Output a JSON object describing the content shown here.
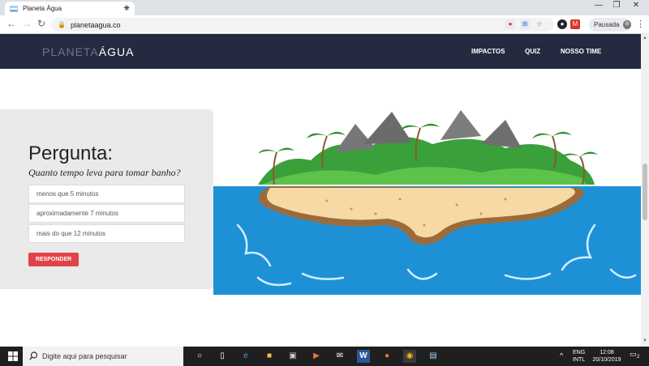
{
  "browser": {
    "tab_title": "Planeta Água",
    "tab_close": "✕",
    "new_tab": "+",
    "window_minimize": "—",
    "window_restore": "❐",
    "window_close": "✕",
    "back": "←",
    "forward": "→",
    "reload": "↻",
    "url": "planetaagua.co",
    "star": "☆",
    "profile_label": "Pausada",
    "menu": "⋮"
  },
  "site": {
    "logo_part1": "PLANETA",
    "logo_part2": "ÁGUA",
    "nav": [
      "IMPACTOS",
      "QUIZ",
      "NOSSO TIME"
    ]
  },
  "quiz": {
    "heading": "Pergunta:",
    "question": "Quanto tempo leva para tomar banho?",
    "options": [
      "menos que 5 minutos",
      "aproximadamente 7 minutos",
      "mais do que 12 minutos"
    ],
    "submit_label": "RESPONDER"
  },
  "taskbar": {
    "search_placeholder": "Digite aqui para pesquisar",
    "lang_top": "ENG",
    "lang_bottom": "INTL",
    "time": "12:08",
    "date": "20/10/2019",
    "notification_count": "2"
  },
  "colors": {
    "nav_bg": "#252a40",
    "submit_bg": "#e04448",
    "card_bg": "#eaeaea",
    "sea": "#1e90d6"
  }
}
